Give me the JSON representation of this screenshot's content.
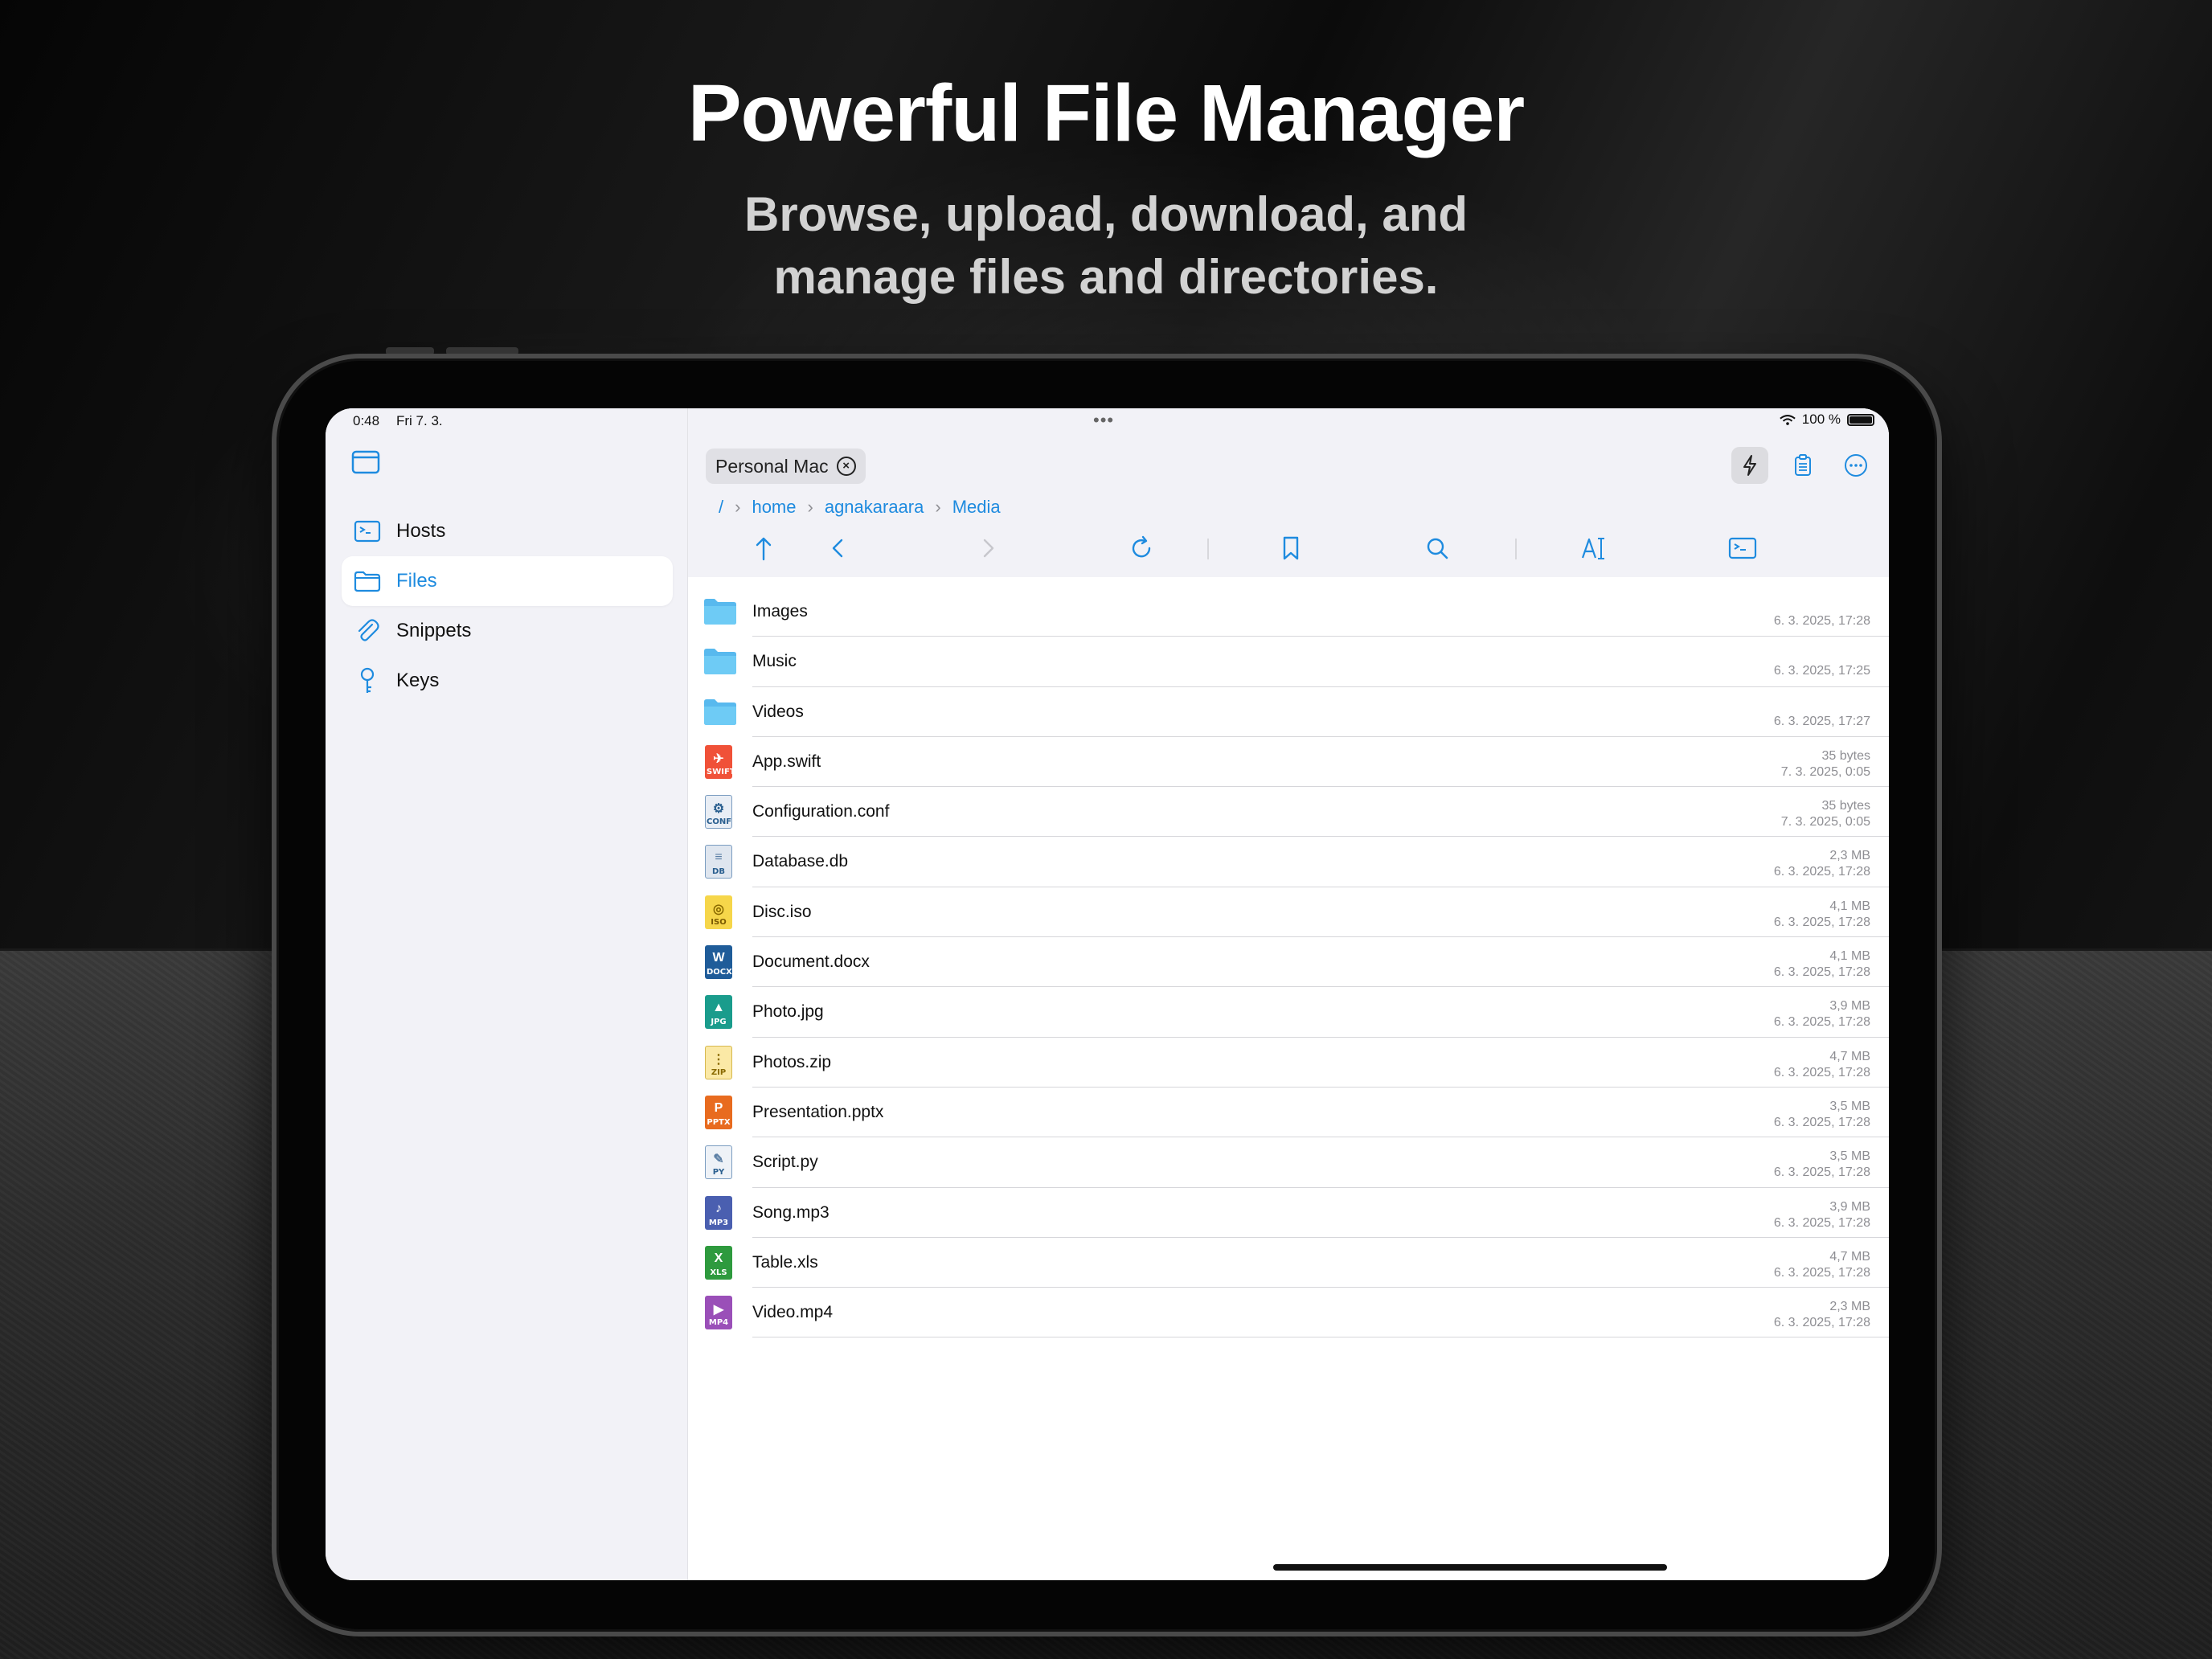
{
  "hero": {
    "title": "Powerful File Manager",
    "subtitle_line1": "Browse, upload, download, and",
    "subtitle_line2": "manage files and directories."
  },
  "status_bar": {
    "time": "0:48",
    "date": "Fri 7. 3.",
    "battery": "100 %"
  },
  "sidebar": {
    "items": [
      {
        "label": "Hosts",
        "icon": "terminal-icon",
        "selected": false
      },
      {
        "label": "Files",
        "icon": "folder-icon",
        "selected": true
      },
      {
        "label": "Snippets",
        "icon": "paperclip-icon",
        "selected": false
      },
      {
        "label": "Keys",
        "icon": "key-icon",
        "selected": false
      }
    ]
  },
  "header": {
    "host_chip": "Personal Mac",
    "breadcrumb": [
      "/",
      "home",
      "agnakaraara",
      "Media"
    ]
  },
  "colors": {
    "accent": "#1e8bdf",
    "sidebar_bg": "#f2f2f7",
    "folder": "#5ac8fa"
  },
  "files": [
    {
      "name": "Images",
      "type": "folder",
      "size": "",
      "date": "6. 3. 2025, 17:28"
    },
    {
      "name": "Music",
      "type": "folder",
      "size": "",
      "date": "6. 3. 2025, 17:25"
    },
    {
      "name": "Videos",
      "type": "folder",
      "size": "",
      "date": "6. 3. 2025, 17:27"
    },
    {
      "name": "App.swift",
      "type": "SWIFT",
      "size": "35 bytes",
      "date": "7. 3. 2025, 0:05"
    },
    {
      "name": "Configuration.conf",
      "type": "CONF",
      "size": "35 bytes",
      "date": "7. 3. 2025, 0:05"
    },
    {
      "name": "Database.db",
      "type": "DB",
      "size": "2,3 MB",
      "date": "6. 3. 2025, 17:28"
    },
    {
      "name": "Disc.iso",
      "type": "ISO",
      "size": "4,1 MB",
      "date": "6. 3. 2025, 17:28"
    },
    {
      "name": "Document.docx",
      "type": "DOCX",
      "size": "4,1 MB",
      "date": "6. 3. 2025, 17:28"
    },
    {
      "name": "Photo.jpg",
      "type": "JPG",
      "size": "3,9 MB",
      "date": "6. 3. 2025, 17:28"
    },
    {
      "name": "Photos.zip",
      "type": "ZIP",
      "size": "4,7 MB",
      "date": "6. 3. 2025, 17:28"
    },
    {
      "name": "Presentation.pptx",
      "type": "PPTX",
      "size": "3,5 MB",
      "date": "6. 3. 2025, 17:28"
    },
    {
      "name": "Script.py",
      "type": "PY",
      "size": "3,5 MB",
      "date": "6. 3. 2025, 17:28"
    },
    {
      "name": "Song.mp3",
      "type": "MP3",
      "size": "3,9 MB",
      "date": "6. 3. 2025, 17:28"
    },
    {
      "name": "Table.xls",
      "type": "XLS",
      "size": "4,7 MB",
      "date": "6. 3. 2025, 17:28"
    },
    {
      "name": "Video.mp4",
      "type": "MP4",
      "size": "2,3 MB",
      "date": "6. 3. 2025, 17:28"
    }
  ]
}
